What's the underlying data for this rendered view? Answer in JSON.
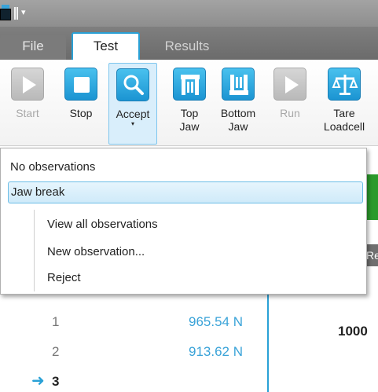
{
  "qat": {
    "menu_glyph": "▾"
  },
  "tabs": {
    "file": "File",
    "test": "Test",
    "results": "Results"
  },
  "ribbon": {
    "start": "Start",
    "stop": "Stop",
    "accept": "Accept",
    "accept_arrow": "▾",
    "top_jaw": [
      "Top",
      "Jaw"
    ],
    "bottom_jaw": [
      "Bottom",
      "Jaw"
    ],
    "run": "Run",
    "tare_loadcell": [
      "Tare",
      "Loadcell"
    ]
  },
  "menu": {
    "no_observations": "No observations",
    "jaw_break": "Jaw break",
    "view_all": "View all observations",
    "new_observation": "New observation...",
    "reject": "Reject"
  },
  "background": {
    "strip_text": "Re",
    "column_header": "...",
    "rows": [
      {
        "num": "1",
        "value": "965.54 N"
      },
      {
        "num": "2",
        "value": "913.62 N"
      }
    ],
    "current_row": "3",
    "right_value": "1000"
  },
  "colors": {
    "accent": "#2aa1d6",
    "value_blue": "#3aa3d8",
    "green": "#2b9a2b"
  }
}
